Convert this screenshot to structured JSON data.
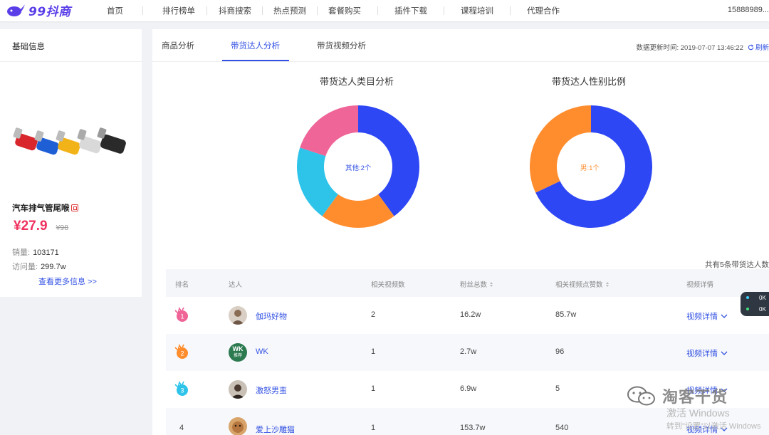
{
  "brand": {
    "logo_text": "99抖商"
  },
  "nav": {
    "items": [
      "首页",
      "排行榜单",
      "抖商搜索",
      "热点预测",
      "套餐购买",
      "插件下载",
      "课程培训",
      "代理合作"
    ],
    "phone": "15888989..."
  },
  "product": {
    "section_title": "基础信息",
    "name": "汽车排气管尾喉",
    "price": "¥27.9",
    "original_price": "¥98",
    "sales_label": "销量:",
    "sales_value": "103171",
    "visits_label": "访问量:",
    "visits_value": "299.7w",
    "more_link": "查看更多信息 >>"
  },
  "tabs": [
    {
      "label": "商品分析",
      "active": false
    },
    {
      "label": "带货达人分析",
      "active": true
    },
    {
      "label": "带货视频分析",
      "active": false
    }
  ],
  "update": {
    "text": "数据更新时间: 2019-07-07 13:46:22",
    "refresh": "刷新"
  },
  "charts": {
    "category_title": "带货达人类目分析",
    "category_center": "其他:2个",
    "gender_title": "带货达人性别比例",
    "gender_center": "男:1个"
  },
  "chart_data": [
    {
      "type": "pie",
      "title": "带货达人类目分析",
      "values": [
        2,
        1,
        1,
        1
      ],
      "colors": [
        "#2e47f5",
        "#ff8d2e",
        "#2ec4ea",
        "#ef6597"
      ]
    },
    {
      "type": "pie",
      "title": "带货达人性别比例",
      "values": [
        0.68,
        0.32
      ],
      "colors": [
        "#2e47f5",
        "#ff8d2e"
      ]
    }
  ],
  "table": {
    "total_text": "共有5条带货达人数",
    "headers": {
      "rank": "排名",
      "talent": "达人",
      "videos": "相关视频数",
      "fans": "粉丝总数",
      "likes": "相关视频点赞数",
      "detail": "视频详情"
    },
    "rows": [
      {
        "rank": "1",
        "name": "伽玛好物",
        "videos": "2",
        "fans": "16.2w",
        "likes": "85.7w",
        "detail": "视频详情"
      },
      {
        "rank": "2",
        "name": "WK",
        "videos": "1",
        "fans": "2.7w",
        "likes": "96",
        "detail": "视频详情"
      },
      {
        "rank": "3",
        "name": "激怒男蛮",
        "videos": "1",
        "fans": "6.9w",
        "likes": "5",
        "detail": "视频详情"
      },
      {
        "rank": "4",
        "name": "爱上沙雕猫",
        "videos": "1",
        "fans": "153.7w",
        "likes": "540",
        "detail": "视频详情"
      }
    ],
    "avatar_wk_text": "WK",
    "avatar_wk_sub": "推荐"
  },
  "widget": {
    "up": "0K",
    "down": "0K"
  },
  "overlay": {
    "watermark": "淘客干货",
    "activate_title": "激活 Windows",
    "activate_sub": "转到\"设置\"以激活 Windows"
  },
  "colors": {
    "accent": "#3352e3",
    "price": "#f0315e",
    "rank1": "#ef6597",
    "rank2": "#ff8d2e",
    "rank3": "#2ec4ea"
  }
}
